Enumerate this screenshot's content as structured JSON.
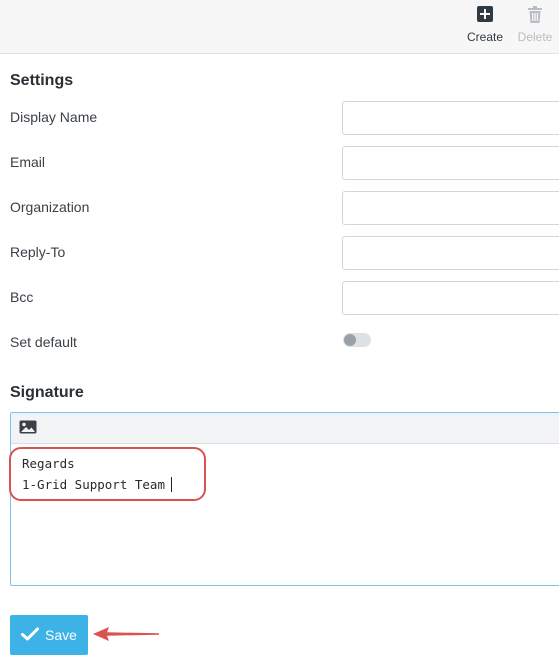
{
  "toolbar": {
    "create_label": "Create",
    "create_icon": "plus-square-icon",
    "delete_label": "Delete",
    "delete_icon": "trash-icon"
  },
  "settings": {
    "heading": "Settings",
    "fields": [
      {
        "label": "Display Name",
        "value": ""
      },
      {
        "label": "Email",
        "value": ""
      },
      {
        "label": "Organization",
        "value": ""
      },
      {
        "label": "Reply-To",
        "value": ""
      },
      {
        "label": "Bcc",
        "value": ""
      }
    ],
    "set_default_label": "Set default",
    "set_default_on": false
  },
  "signature": {
    "heading": "Signature",
    "toolbar_icon": "image-icon",
    "lines": [
      "Regards",
      "1-Grid Support Team"
    ]
  },
  "save_label": "Save",
  "colors": {
    "accent": "#3db2e6",
    "annotation": "#d9534f"
  }
}
